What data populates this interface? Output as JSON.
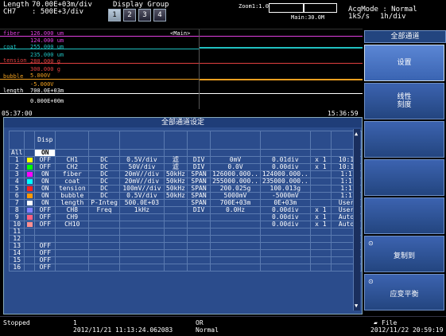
{
  "header": {
    "length_label": "Length",
    "length_value": "70.00E+03m/div",
    "ch_label": "CH7",
    "ch_value": ": 500E+3/div",
    "display_group_label": "Display Group",
    "groups": [
      "1",
      "2",
      "3",
      "4"
    ],
    "zoom_label": "Zoom1:1.0M",
    "main_label": "Main:30.0M",
    "acq_mode": "AcqMode : Normal",
    "rate": "1kS/s",
    "time_div": "1h/div"
  },
  "wave": {
    "labels": [
      {
        "text": "fiber",
        "color": "#e040e0"
      },
      {
        "text": "coat",
        "color": "#20c0c0"
      },
      {
        "text": "tension",
        "color": "#e04040"
      },
      {
        "text": "bubble",
        "color": "#f0a020"
      },
      {
        "text": "length",
        "color": "#ffffff"
      }
    ],
    "scale_texts": [
      "126.000 um",
      "124.000 um",
      "255.000 um",
      "235.000 um",
      "280.000 g",
      "300.000 g",
      "5.000V",
      "-5.000V",
      "700.0E+03m",
      "0.000E+00m"
    ],
    "main_tag": "<Main>",
    "time_left": "05:37:00",
    "time_right": "15:36:59"
  },
  "dialog": {
    "title": "全部通道设定",
    "disp_header": "Disp",
    "all_label": "All",
    "all_disp": "ON",
    "rows": [
      {
        "n": "1",
        "color": "#ffff00",
        "disp": "OFF",
        "name": "CH1",
        "type": "DC",
        "range": "0.5V/div",
        "filter": "滤",
        "mode": "DIV",
        "zero": "0mV",
        "pos": "0.01div",
        "mult": "x 1",
        "ratio": "10:1"
      },
      {
        "n": "2",
        "color": "#00ff00",
        "disp": "OFF",
        "name": "CH2",
        "type": "DC",
        "range": "50V/div",
        "filter": "滤",
        "mode": "DIV",
        "zero": "0.0V",
        "pos": "0.00div",
        "mult": "x 1",
        "ratio": "10:1"
      },
      {
        "n": "3",
        "color": "#ff00ff",
        "disp": "ON",
        "name": "fiber",
        "type": "DC",
        "range": "20mV//div",
        "filter": "50kHz",
        "mode": "SPAN",
        "zero": "126000.000..",
        "pos": "124000.000..",
        "mult": "",
        "ratio": "1:1"
      },
      {
        "n": "4",
        "color": "#00ffff",
        "disp": "ON",
        "name": "coat",
        "type": "DC",
        "range": "20mV//div",
        "filter": "50kHz",
        "mode": "SPAN",
        "zero": "255000.000..",
        "pos": "235000.000..",
        "mult": "",
        "ratio": "1:1"
      },
      {
        "n": "5",
        "color": "#ff2020",
        "disp": "ON",
        "name": "tension",
        "type": "DC",
        "range": "100mV//div",
        "filter": "50kHz",
        "mode": "SPAN",
        "zero": "200.025g",
        "pos": "100.013g",
        "mult": "",
        "ratio": "1:1"
      },
      {
        "n": "6",
        "color": "#ff9900",
        "disp": "ON",
        "name": "bubble",
        "type": "DC",
        "range": "0.5V/div",
        "filter": "50kHz",
        "mode": "SPAN",
        "zero": "5000mV",
        "pos": "-5000mV",
        "mult": "",
        "ratio": "1:1"
      },
      {
        "n": "7",
        "color": "#ffffff",
        "disp": "ON",
        "name": "length",
        "type": "P-Integ",
        "range": "500.0E+03",
        "filter": "",
        "mode": "SPAN",
        "zero": "700E+03m",
        "pos": "0E+03m",
        "mult": "",
        "ratio": "User"
      },
      {
        "n": "8",
        "color": "#8080ff",
        "disp": "OFF",
        "name": "CH8",
        "type": "Freq",
        "range": "1kHz",
        "filter": "",
        "mode": "DIV",
        "zero": "0.0Hz",
        "pos": "0.00div",
        "mult": "x 1",
        "ratio": "User"
      },
      {
        "n": "9",
        "color": "#ff6080",
        "disp": "OFF",
        "name": "CH9",
        "type": "",
        "range": "",
        "filter": "",
        "mode": "",
        "zero": "",
        "pos": "0.00div",
        "mult": "x 1",
        "ratio": "Auto"
      },
      {
        "n": "10",
        "color": "#ff9090",
        "disp": "OFF",
        "name": "CH10",
        "type": "",
        "range": "",
        "filter": "",
        "mode": "",
        "zero": "",
        "pos": "0.00div",
        "mult": "x 1",
        "ratio": "Auto"
      },
      {
        "n": "11",
        "color": "",
        "disp": "",
        "name": "",
        "type": "",
        "range": "",
        "filter": "",
        "mode": "",
        "zero": "",
        "pos": "",
        "mult": "",
        "ratio": ""
      },
      {
        "n": "12",
        "color": "",
        "disp": "",
        "name": "",
        "type": "",
        "range": "",
        "filter": "",
        "mode": "",
        "zero": "",
        "pos": "",
        "mult": "",
        "ratio": ""
      },
      {
        "n": "13",
        "color": "",
        "disp": "OFF",
        "name": "",
        "type": "",
        "range": "",
        "filter": "",
        "mode": "",
        "zero": "",
        "pos": "",
        "mult": "",
        "ratio": ""
      },
      {
        "n": "14",
        "color": "",
        "disp": "OFF",
        "name": "",
        "type": "",
        "range": "",
        "filter": "",
        "mode": "",
        "zero": "",
        "pos": "",
        "mult": "",
        "ratio": ""
      },
      {
        "n": "15",
        "color": "",
        "disp": "OFF",
        "name": "",
        "type": "",
        "range": "",
        "filter": "",
        "mode": "",
        "zero": "",
        "pos": "",
        "mult": "",
        "ratio": ""
      },
      {
        "n": "16",
        "color": "",
        "disp": "OFF",
        "name": "",
        "type": "",
        "range": "",
        "filter": "",
        "mode": "",
        "zero": "",
        "pos": "",
        "mult": "",
        "ratio": ""
      }
    ]
  },
  "side": {
    "title": "全部通道",
    "setup": "设置",
    "linear_1": "线性",
    "linear_2": "刻度",
    "copy": "复制到",
    "balance": "应变平衡"
  },
  "status": {
    "state": "Stopped",
    "count": "1",
    "start_time": "2012/11/21 11:13:24.062083",
    "or_label": "OR",
    "normal": "Normal",
    "file_label": "File",
    "end_time": "2012/11/22 20:59:19"
  }
}
